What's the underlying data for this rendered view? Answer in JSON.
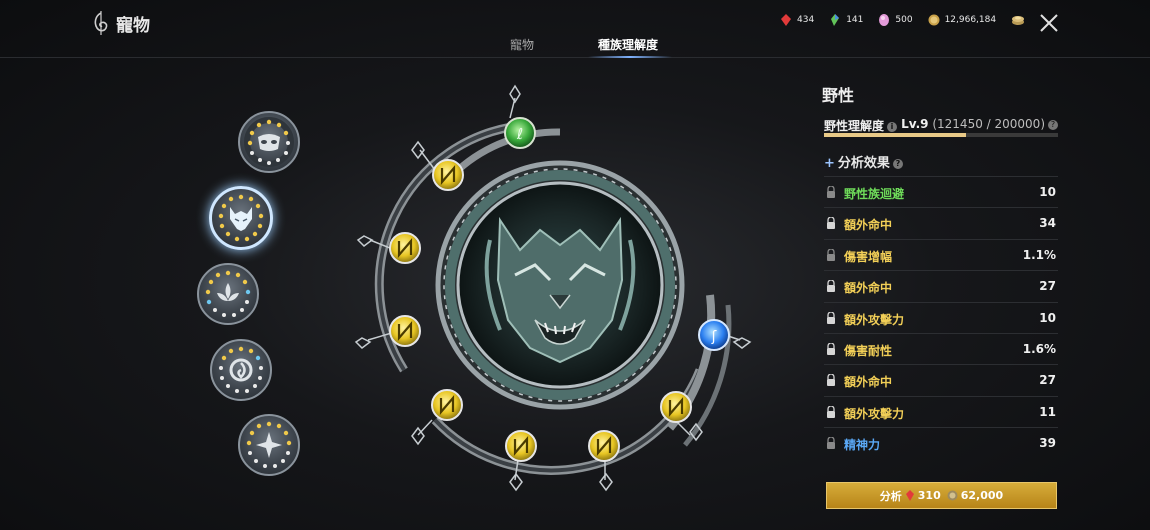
{
  "header": {
    "title": "寵物",
    "tabs": [
      {
        "label": "寵物"
      },
      {
        "label": "種族理解度"
      }
    ],
    "currencies": [
      {
        "icon": "red-crystal-icon",
        "value": "434",
        "color": "#e23a3a"
      },
      {
        "icon": "green-crystal-icon",
        "value": "141",
        "color": "#62c35a"
      },
      {
        "icon": "pink-gem-icon",
        "value": "500",
        "color": "#e39ad8"
      },
      {
        "icon": "gold-coin-icon",
        "value": "12,966,184",
        "color": "#c9a14a"
      }
    ]
  },
  "panel": {
    "title": "野性",
    "level_label": "野性理解度",
    "level": "Lv.9",
    "progress_text": "(121450 / 200000)",
    "progress_fraction": 0.607,
    "analysis_label": "分析效果",
    "stats": [
      {
        "name": "野性族迴避",
        "value": "10",
        "color": "#6fdc5a"
      },
      {
        "name": "額外命中",
        "value": "34",
        "color": "#f2cf57"
      },
      {
        "name": "傷害增幅",
        "value": "1.1%",
        "color": "#f2cf57"
      },
      {
        "name": "額外命中",
        "value": "27",
        "color": "#f2cf57"
      },
      {
        "name": "額外攻擊力",
        "value": "10",
        "color": "#f2cf57"
      },
      {
        "name": "傷害耐性",
        "value": "1.6%",
        "color": "#f2cf57"
      },
      {
        "name": "額外命中",
        "value": "27",
        "color": "#f2cf57"
      },
      {
        "name": "額外攻擊力",
        "value": "11",
        "color": "#f2cf57"
      },
      {
        "name": "精神力",
        "value": "39",
        "color": "#5aa8f5"
      }
    ],
    "button": {
      "label": "分析",
      "cost_crystal": "310",
      "cost_gold": "62,000"
    }
  }
}
